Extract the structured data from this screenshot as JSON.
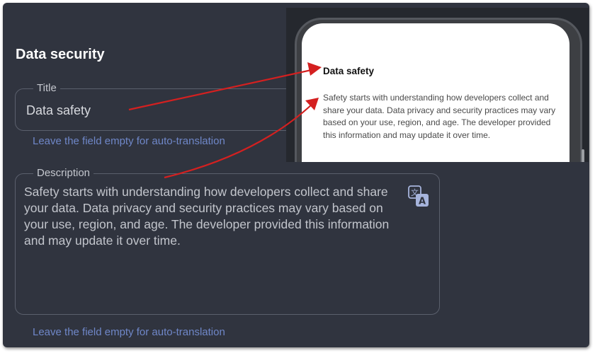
{
  "section": {
    "title": "Data security"
  },
  "title_field": {
    "label": "Title",
    "value": "Data safety",
    "hint": "Leave the field empty for auto-translation"
  },
  "description_field": {
    "label": "Description",
    "value": "Safety starts with understanding how developers collect and share your data. Data privacy and security practices may vary based on your use, region, and age. The developer provided this information and may update it over time.",
    "hint": "Leave the field empty for auto-translation",
    "icon": "translate-icon"
  },
  "preview": {
    "title": "Data safety",
    "body": "Safety starts with understanding how developers collect and share your data. Data privacy and security practices may vary based on your use, region, and age. The developer provided this information and may update it over time."
  },
  "colors": {
    "panel_bg": "#30343f",
    "hint": "#6f87c8",
    "arrow": "#d42020",
    "translate_icon": "#a6b4dc"
  }
}
